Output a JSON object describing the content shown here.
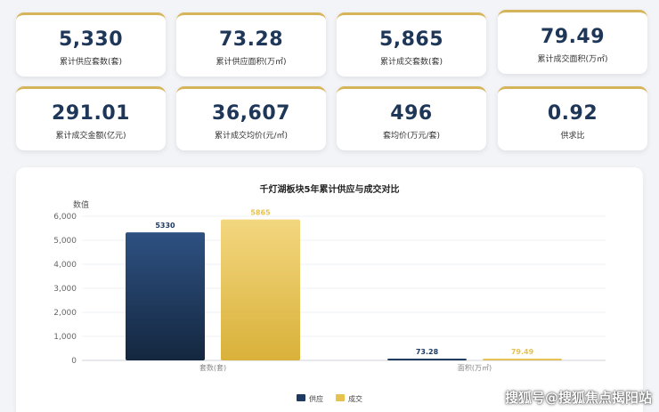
{
  "stats": [
    {
      "value": "5,330",
      "label": "累计供应套数(套)"
    },
    {
      "value": "73.28",
      "label": "累计供应面积(万㎡)"
    },
    {
      "value": "5,865",
      "label": "累计成交套数(套)"
    },
    {
      "value": "79.49",
      "label": "累计成交面积(万㎡)"
    },
    {
      "value": "291.01",
      "label": "累计成交金额(亿元)"
    },
    {
      "value": "36,607",
      "label": "累计成交均价(元/㎡)"
    },
    {
      "value": "496",
      "label": "套均价(万元/套)"
    },
    {
      "value": "0.92",
      "label": "供求比"
    }
  ],
  "chart_data": {
    "type": "bar",
    "title": "千灯湖板块5年累计供应与成交对比",
    "ylabel": "数值",
    "xlabel": "",
    "categories": [
      "套数(套)",
      "面积(万㎡)"
    ],
    "series": [
      {
        "name": "供应",
        "values": [
          5330,
          73.28
        ],
        "color": "#1e3a63"
      },
      {
        "name": "成交",
        "values": [
          5865,
          79.49
        ],
        "color": "#e6c24e"
      }
    ],
    "data_labels": [
      [
        "5330",
        "73.28"
      ],
      [
        "5865",
        "79.49"
      ]
    ],
    "ylim": [
      0,
      6000
    ],
    "yticks": [
      "0",
      "1,000",
      "2,000",
      "3,000",
      "4,000",
      "5,000",
      "6,000"
    ],
    "grid": true,
    "legend": "bottom-center"
  },
  "watermark": "搜狐号@搜狐焦点揭阳站"
}
